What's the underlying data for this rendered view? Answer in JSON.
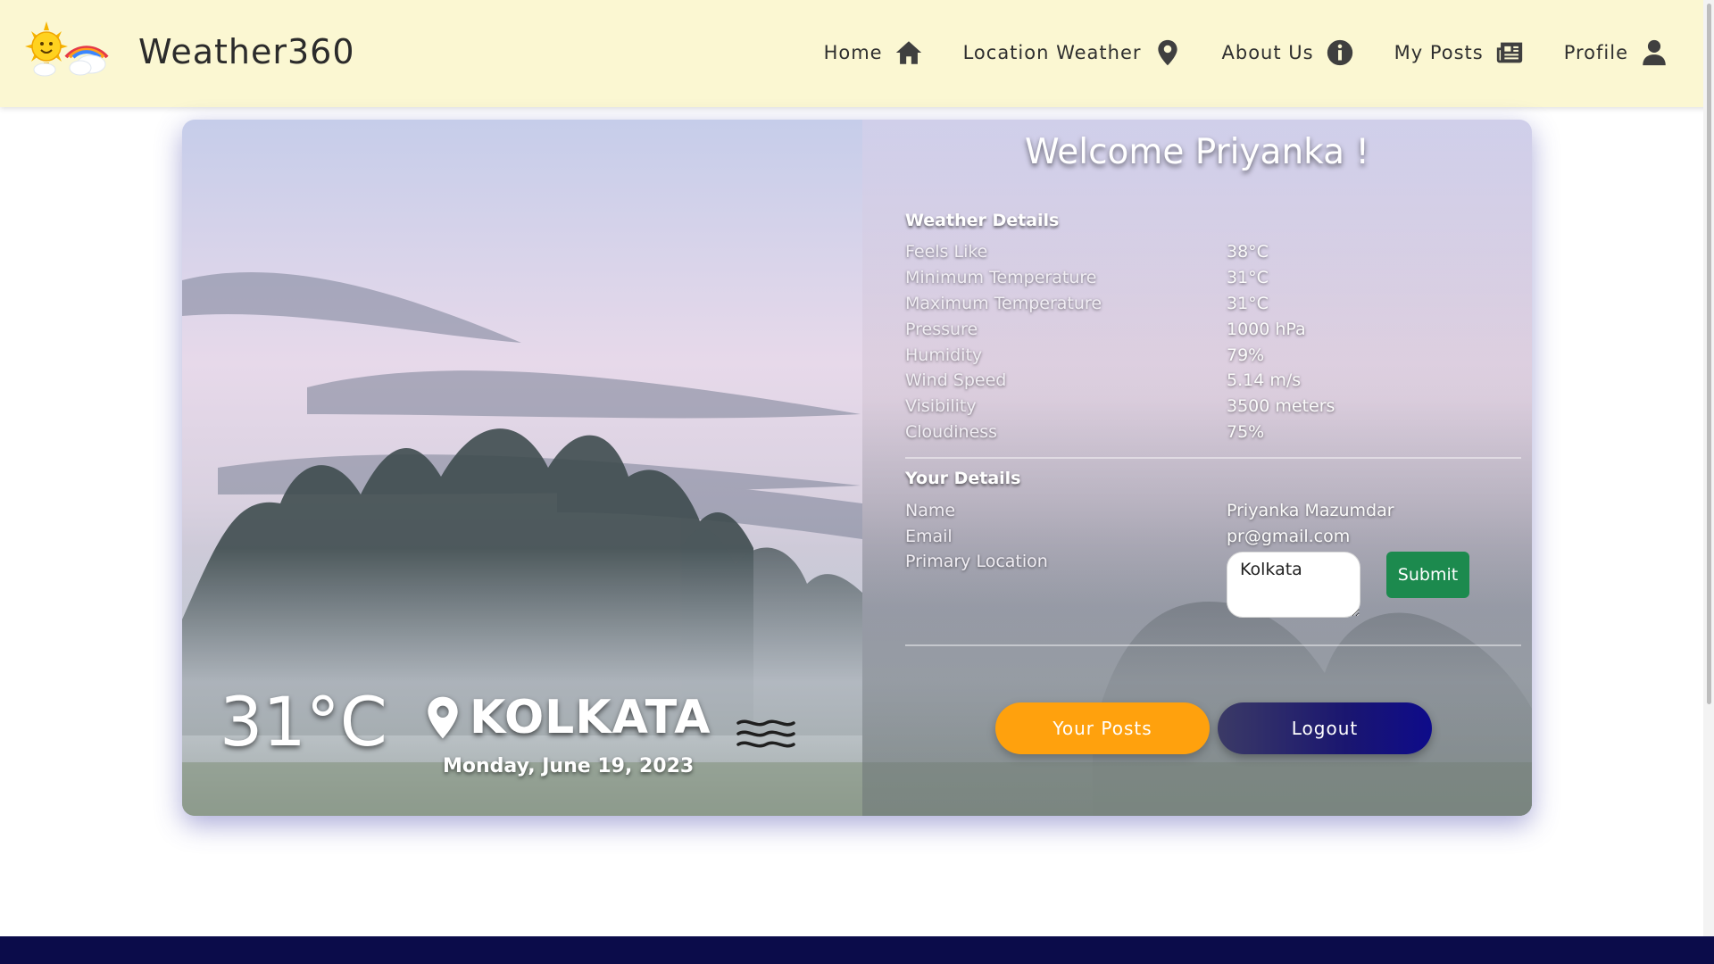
{
  "brand": {
    "title": "Weather360"
  },
  "nav": {
    "items": [
      {
        "label": "Home",
        "icon": "home-icon"
      },
      {
        "label": "Location Weather",
        "icon": "map-pin-icon"
      },
      {
        "label": "About Us",
        "icon": "info-icon"
      },
      {
        "label": "My Posts",
        "icon": "newspaper-icon"
      },
      {
        "label": "Profile",
        "icon": "user-icon"
      }
    ]
  },
  "current": {
    "temperature": "31°C",
    "city": "KOLKATA",
    "date": "Monday, June 19, 2023",
    "condition_icon": "mist-icon"
  },
  "welcome": "Welcome Priyanka !",
  "weather_details": {
    "title": "Weather Details",
    "rows": [
      {
        "label": "Feels Like",
        "value": "38°C"
      },
      {
        "label": "Minimum Temperature",
        "value": "31°C"
      },
      {
        "label": "Maximum Temperature",
        "value": "31°C"
      },
      {
        "label": "Pressure",
        "value": "1000 hPa"
      },
      {
        "label": "Humidity",
        "value": "79%"
      },
      {
        "label": "Wind Speed",
        "value": "5.14 m/s"
      },
      {
        "label": "Visibility",
        "value": "3500 meters"
      },
      {
        "label": "Cloudiness",
        "value": "75%"
      }
    ]
  },
  "user_details": {
    "title": "Your Details",
    "name_label": "Name",
    "name": "Priyanka Mazumdar",
    "email_label": "Email",
    "email": "pr@gmail.com",
    "location_label": "Primary Location",
    "location_value": "Kolkata",
    "submit_label": "Submit"
  },
  "actions": {
    "posts_label": "Your Posts",
    "logout_label": "Logout"
  },
  "colors": {
    "navbar_bg": "#fbf7d2",
    "submit_bg": "#1c8a4e",
    "posts_bg": "#ffa10d",
    "logout_bg": "#1a1670",
    "footer_bg": "#0b0c4a"
  }
}
